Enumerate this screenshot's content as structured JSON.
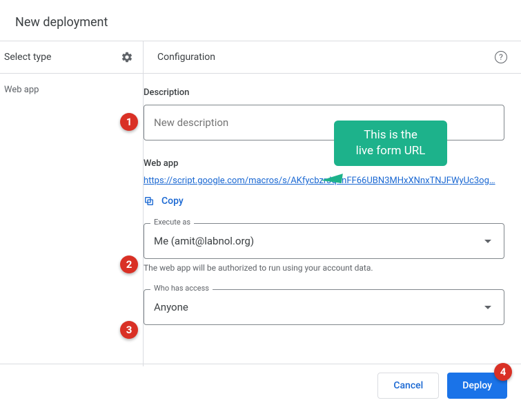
{
  "dialog": {
    "title": "New deployment"
  },
  "left": {
    "header": "Select type",
    "item": "Web app"
  },
  "right": {
    "header": "Configuration",
    "description_label": "Description",
    "description_placeholder": "New description",
    "webapp_label": "Web app",
    "url": "https://script.google.com/macros/s/AKfycbzrJq4nFF66UBN3MHxXNnxTNJFWyUc3og…",
    "copy_label": "Copy",
    "execute_as_label": "Execute as",
    "execute_as_value": "Me (amit@labnol.org)",
    "execute_as_helper": "The web app will be authorized to run using your account data.",
    "access_label": "Who has access",
    "access_value": "Anyone"
  },
  "footer": {
    "cancel": "Cancel",
    "deploy": "Deploy"
  },
  "annotations": {
    "b1": "1",
    "b2": "2",
    "b3": "3",
    "b4": "4",
    "callout_line1": "This is the",
    "callout_line2": "live form URL"
  }
}
